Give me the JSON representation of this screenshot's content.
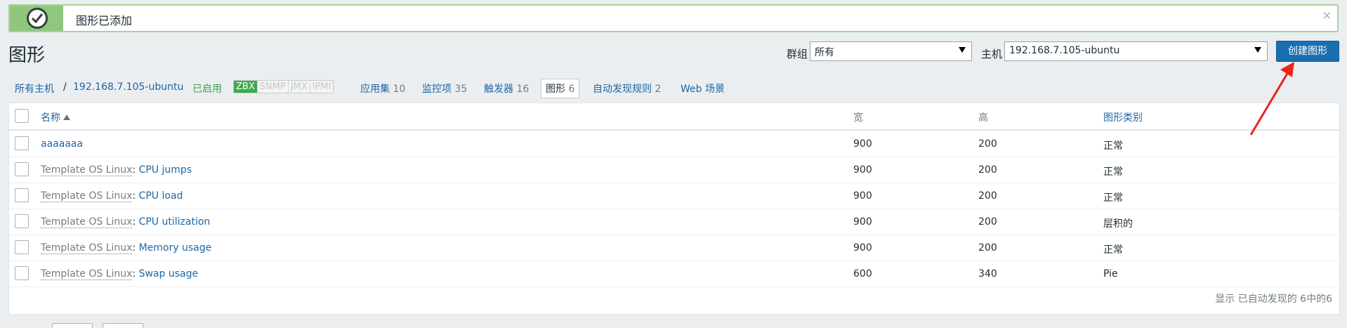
{
  "message": {
    "text": "图形已添加",
    "close": "×"
  },
  "page_title": "图形",
  "filters": {
    "group_label": "群组",
    "group_value": "所有",
    "host_label": "主机",
    "host_value": "192.168.7.105-ubuntu"
  },
  "create_button": "创建图形",
  "nav": {
    "all_hosts": "所有主机",
    "separator": "/",
    "host": "192.168.7.105-ubuntu",
    "enabled": "已启用",
    "badges": [
      "ZBX",
      "SNMP",
      "JMX",
      "IPMI"
    ],
    "applications": "应用集",
    "applications_count": "10",
    "items": "监控项",
    "items_count": "35",
    "triggers": "触发器",
    "triggers_count": "16",
    "graphs": "图形",
    "graphs_count": "6",
    "discovery": "自动发现规则",
    "discovery_count": "2",
    "web": "Web 场景"
  },
  "table": {
    "headers": {
      "name": "名称",
      "width": "宽",
      "height": "高",
      "type": "图形类别"
    },
    "rows": [
      {
        "template": "",
        "name": "aaaaaaa",
        "width": "900",
        "height": "200",
        "type": "正常"
      },
      {
        "template": "Template OS Linux",
        "name": "CPU jumps",
        "width": "900",
        "height": "200",
        "type": "正常"
      },
      {
        "template": "Template OS Linux",
        "name": "CPU load",
        "width": "900",
        "height": "200",
        "type": "正常"
      },
      {
        "template": "Template OS Linux",
        "name": "CPU utilization",
        "width": "900",
        "height": "200",
        "type": "层积的"
      },
      {
        "template": "Template OS Linux",
        "name": "Memory usage",
        "width": "900",
        "height": "200",
        "type": "正常"
      },
      {
        "template": "Template OS Linux",
        "name": "Swap usage",
        "width": "600",
        "height": "340",
        "type": "Pie"
      }
    ],
    "template_sep": ":",
    "footer": "显示 已自动发现的 6中的6"
  },
  "colors": {
    "accent": "#1a6fb0",
    "success": "#3eaa4e",
    "annotation": "#e8261c"
  }
}
